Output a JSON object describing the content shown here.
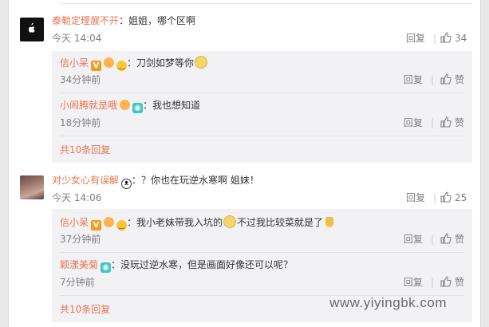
{
  "comments": [
    {
      "user": "泰勒定理展不开",
      "text": "姐姐，哪个区啊",
      "time": "今天 14:04",
      "reply_label": "回复",
      "likes": "34",
      "replies": [
        {
          "user": "信小呆",
          "text": "刀剑如梦等你",
          "time": "34分钟前",
          "reply_label": "回复",
          "like_label": "赞"
        },
        {
          "user": "小闹腾就是哦",
          "text": "我也想知道",
          "time": "18分钟前",
          "reply_label": "回复",
          "like_label": "赞"
        }
      ],
      "more": "共10条回复"
    },
    {
      "user": "对少女心有误解",
      "text": "？你也在玩逆水寒啊  姐妹！",
      "time": "今天 14:06",
      "reply_label": "回复",
      "likes": "25",
      "replies": [
        {
          "user": "信小呆",
          "text": "我小老妹带我入坑的",
          "text2": "不过我比较菜就是了",
          "time": "37分钟前",
          "reply_label": "回复",
          "like_label": "赞"
        },
        {
          "user": "颖漾美菊",
          "text": "没玩过逆水寒，但是画面好像还可以呢？",
          "time": "7分钟前",
          "reply_label": "回复",
          "like_label": "赞"
        }
      ],
      "more": "共10条回复"
    }
  ],
  "watermark": "www.yiyingbk.com",
  "colors": {
    "username": "#eb7350",
    "meta": "#808080",
    "reply_bg": "#f2f2f5"
  },
  "icons": [
    "apple-avatar-icon",
    "thumb-up-icon",
    "vip-badge-icon",
    "emoji-icon",
    "eye-badge-icon",
    "panda-icon",
    "doge-icon"
  ]
}
